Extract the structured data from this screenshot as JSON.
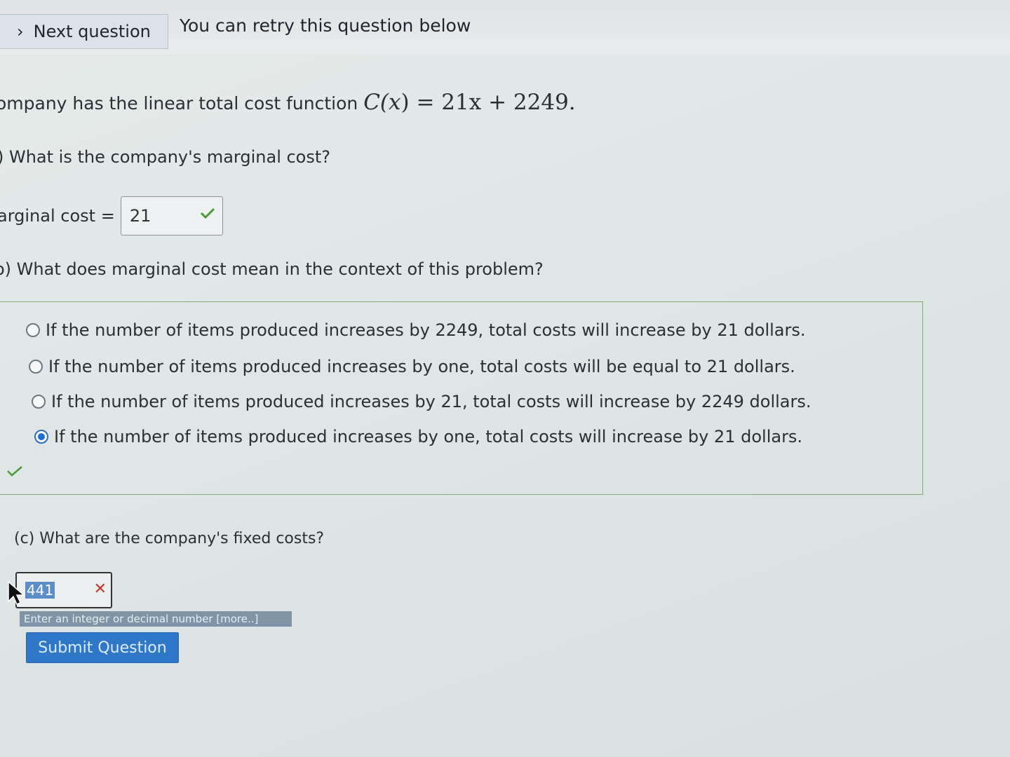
{
  "header": {
    "next_label": "Next question",
    "retry_message": "You can retry this question below"
  },
  "problem": {
    "stem_text": "ompany has the linear total cost function ",
    "stem_math_prefix": "C(",
    "stem_math_var": "x",
    "stem_math_suffix": ") = 21x + 2249."
  },
  "part_a": {
    "question": ") What is the company's marginal cost?",
    "label": "arginal cost =",
    "answer": "21",
    "status": "correct"
  },
  "part_b": {
    "question": "o) What does marginal cost mean in the context of this problem?",
    "choices": [
      "If the number of items produced increases by 2249, total costs will increase by 21 dollars.",
      "If the number of items produced increases by one, total costs will be equal to 21 dollars.",
      "If the number of items produced increases by 21, total costs will increase by 2249 dollars.",
      "If the number of items produced increases by one, total costs will increase by 21 dollars."
    ],
    "selected_index": 3,
    "status": "correct"
  },
  "part_c": {
    "question": "(c) What are the company's fixed costs?",
    "answer": "441",
    "status": "incorrect",
    "hint": "Enter an integer or decimal number [more..]"
  },
  "submit_label": "Submit Question",
  "colors": {
    "correct": "#4a9a3a",
    "incorrect": "#c0392b",
    "accent": "#2f78c8"
  }
}
